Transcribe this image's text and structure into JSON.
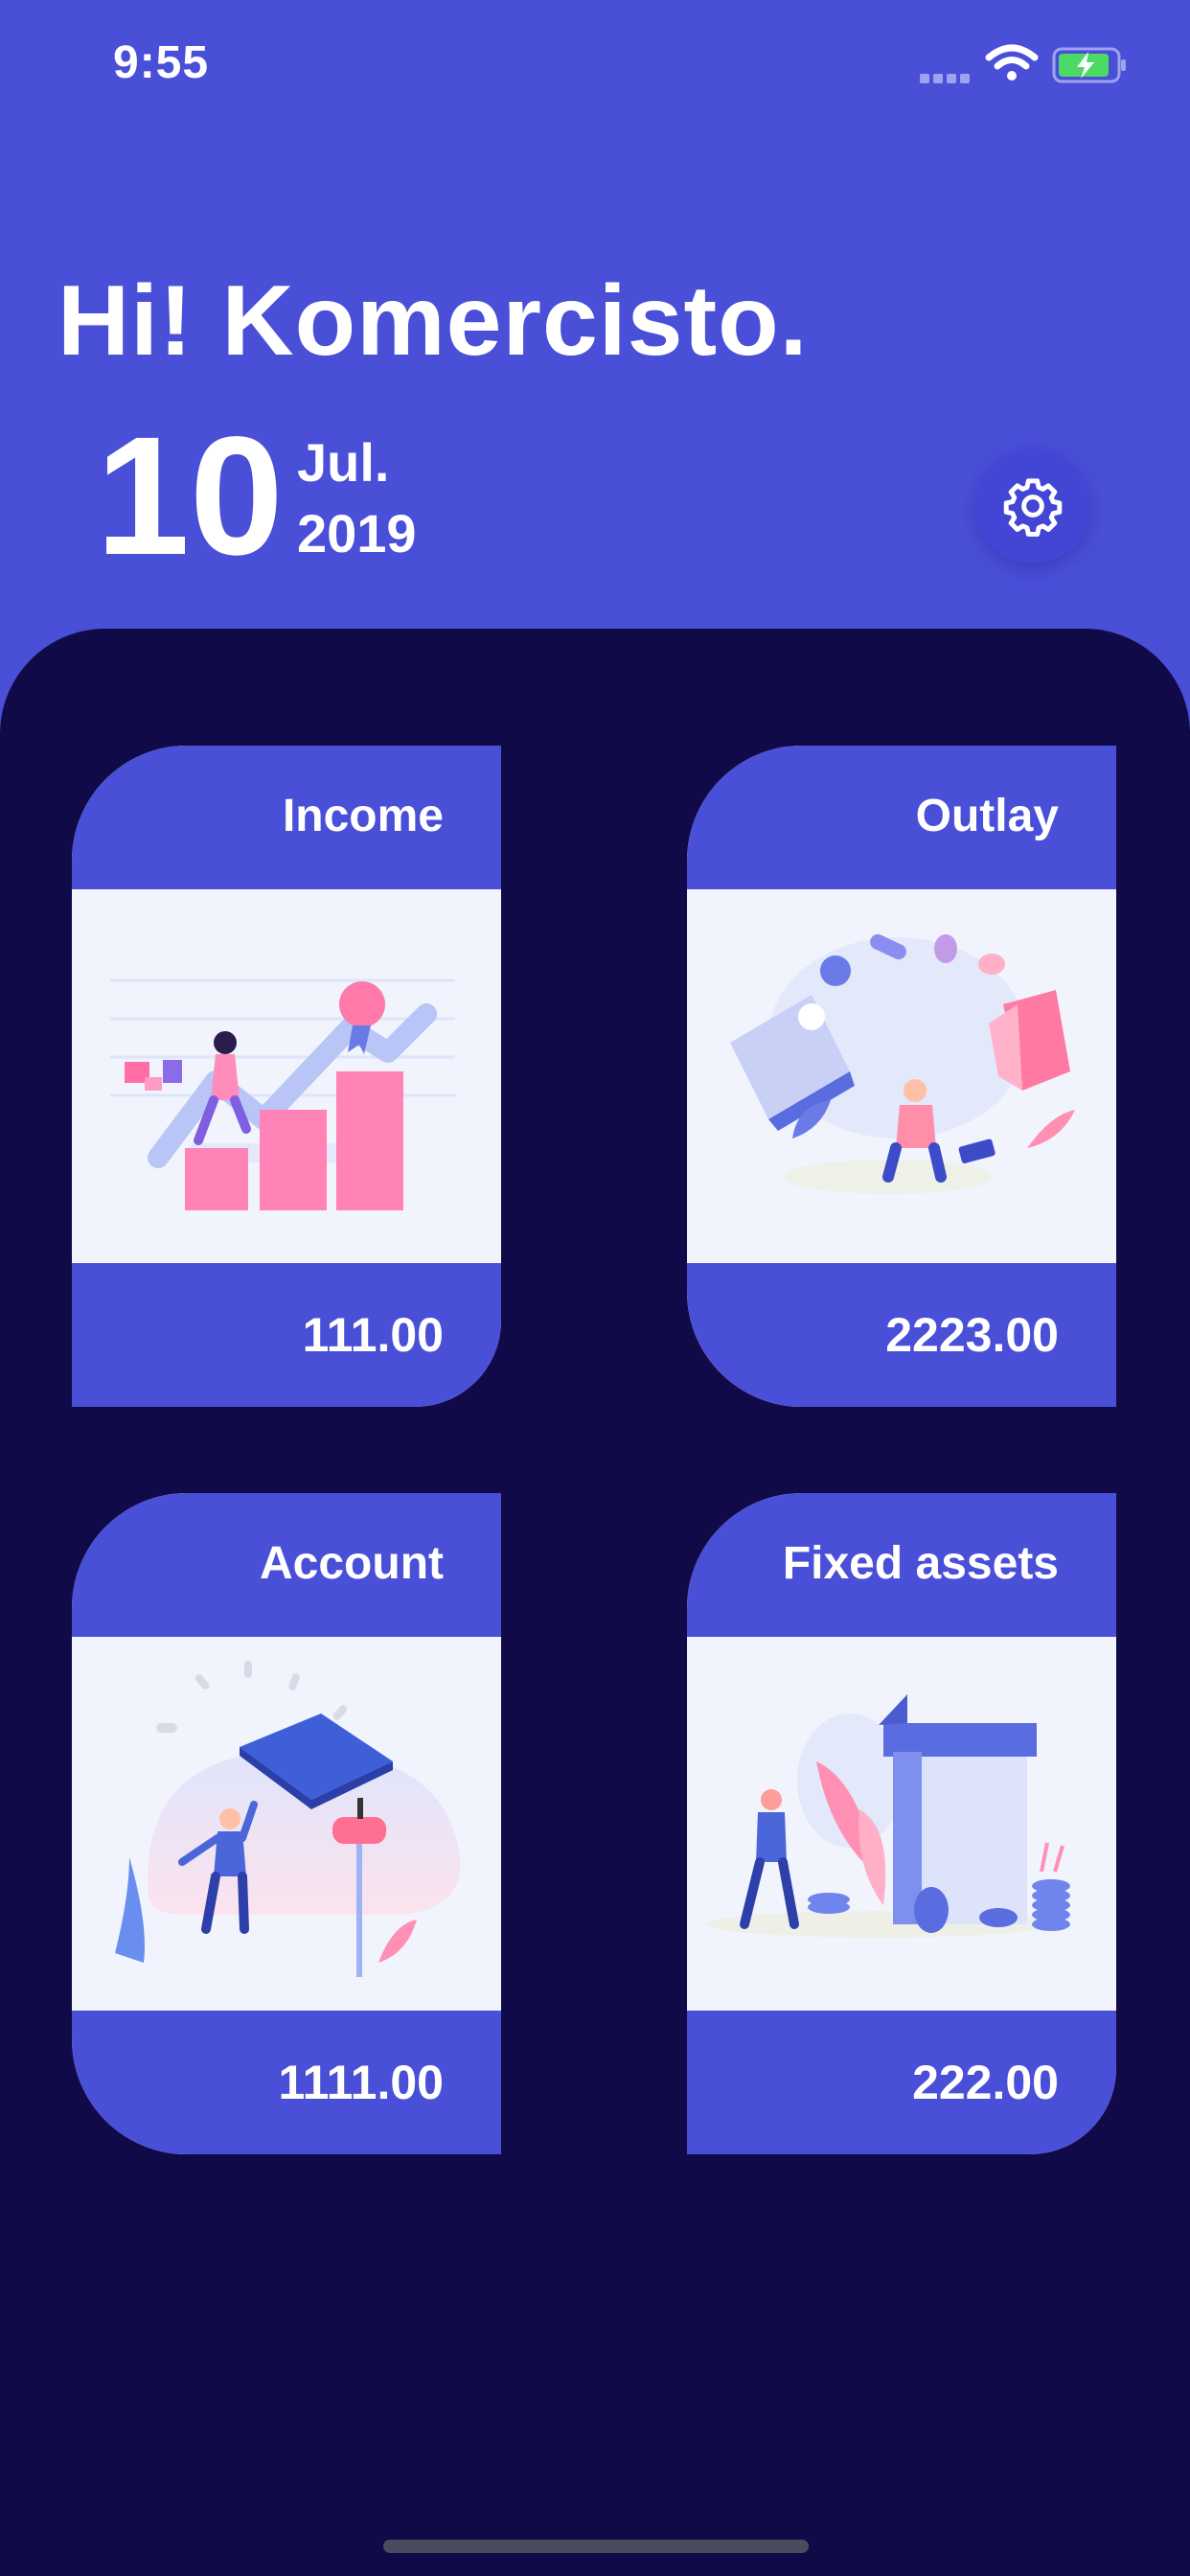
{
  "status_bar": {
    "time": "9:55",
    "icons": [
      "signal-dots-icon",
      "wifi-icon",
      "battery-charging-icon"
    ]
  },
  "header": {
    "greeting": "Hi!  Komercisto.",
    "day": "10",
    "month": "Jul.",
    "year": "2019",
    "settings_icon": "gear-icon"
  },
  "cards": [
    {
      "title": "Income",
      "value": "111.00",
      "illustration": "growth-chart-illustration"
    },
    {
      "title": "Outlay",
      "value": "2223.00",
      "illustration": "shopping-illustration"
    },
    {
      "title": "Account",
      "value": "1111.00",
      "illustration": "credit-card-illustration"
    },
    {
      "title": "Fixed assets",
      "value": "222.00",
      "illustration": "building-coins-illustration"
    }
  ],
  "colors": {
    "accent": "#4a4fd8",
    "panel": "#110a48",
    "card_bg": "#f1f4fd",
    "pink": "#ff7fb1"
  }
}
